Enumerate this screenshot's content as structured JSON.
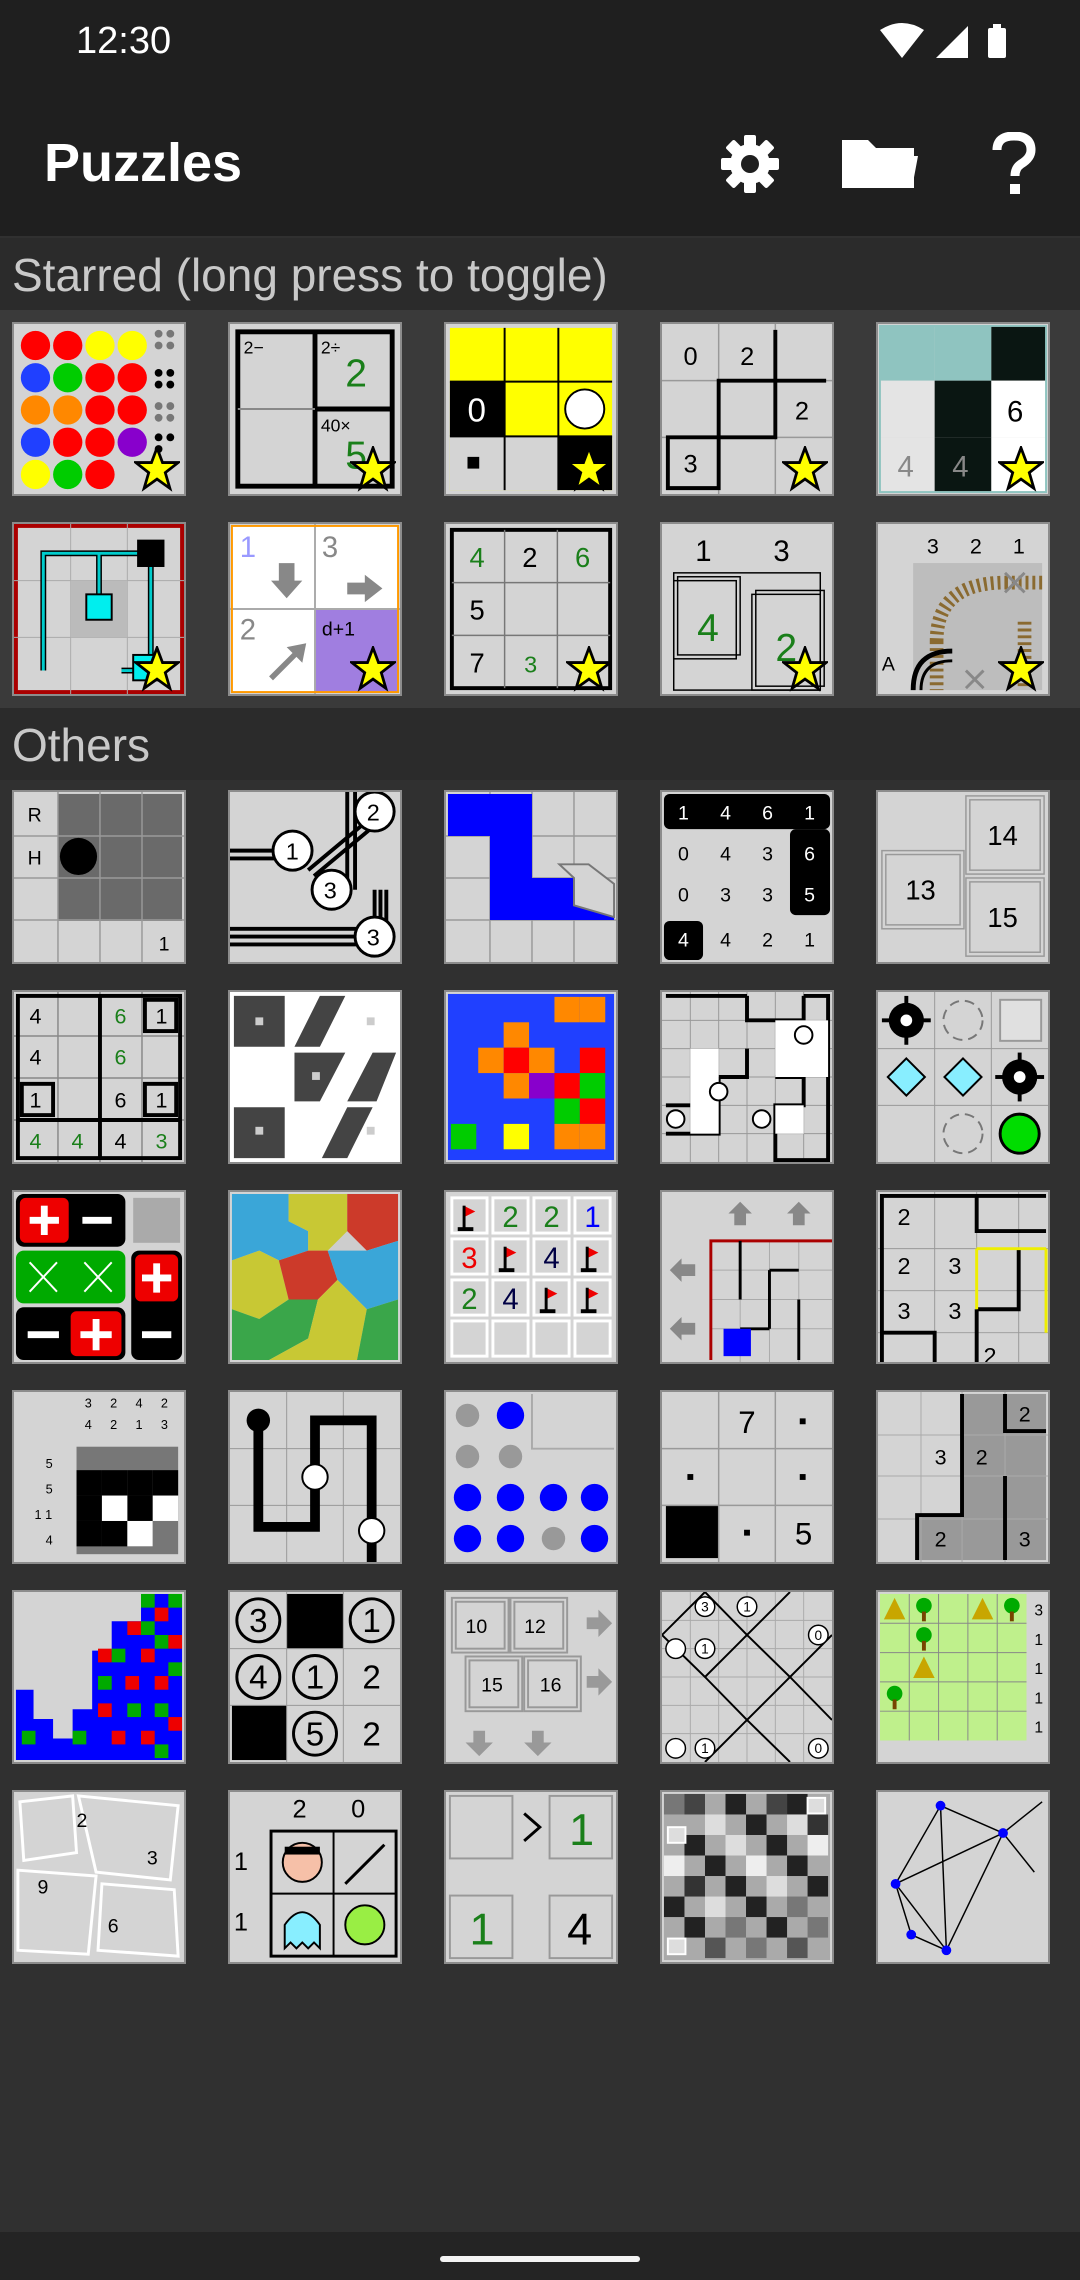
{
  "status_bar": {
    "time": "12:30",
    "icons": [
      "wifi-icon",
      "signal-icon",
      "battery-icon"
    ]
  },
  "app_bar": {
    "title": "Puzzles",
    "actions": [
      "gear-icon",
      "folder-icon",
      "help-icon"
    ]
  },
  "sections": {
    "starred": {
      "header": "Starred (long press to toggle)"
    },
    "others": {
      "header": "Others"
    }
  },
  "tiles_text": {
    "keen": {
      "t1": "2−",
      "t2": "2÷",
      "t3": "2",
      "t4": "40×",
      "t5": "5"
    },
    "lightup": {
      "t1": "0"
    },
    "slant": {
      "t1": "0",
      "t2": "2",
      "t3": "2",
      "t4": "3"
    },
    "unequal_tint": {
      "t1": "6",
      "t2": "4",
      "t3": "4"
    },
    "signpost": {
      "t1": "1",
      "t2": "3",
      "t3": "2",
      "t4": "d+1"
    },
    "towers": {
      "t1": "4",
      "t2": "2",
      "t3": "6",
      "t4": "5",
      "t5": "7",
      "t6": "3"
    },
    "tents_like": {
      "t1": "1",
      "t2": "3",
      "t3": "4",
      "t4": "2"
    },
    "tracks": {
      "t1": "3",
      "t2": "2",
      "t3": "1",
      "t4": "A"
    },
    "pegs_label": {
      "t1": "R",
      "t2": "H",
      "t3": "1"
    },
    "bridges": {
      "t1": "2",
      "t2": "1",
      "t3": "3",
      "t4": "3"
    },
    "range": {
      "r1": [
        "1",
        "4",
        "6",
        "1"
      ],
      "r2": [
        "0",
        "4",
        "3",
        "6"
      ],
      "r3": [
        "0",
        "3",
        "3",
        "5"
      ],
      "r4": [
        "4",
        "4",
        "2",
        "1"
      ]
    },
    "filling": {
      "t1": "14",
      "t2": "13",
      "t3": "15"
    },
    "unruly_grid": {
      "r1": [
        "4",
        "6",
        "1"
      ],
      "r2": [
        "4",
        "6"
      ],
      "r3": [
        "1",
        "6",
        "1"
      ],
      "r4": [
        "4",
        "4",
        "4",
        "3"
      ]
    },
    "mines": {
      "r1": [
        "2",
        "2",
        "1"
      ],
      "r2": [
        "3",
        "4"
      ],
      "r3": [
        "2",
        "4"
      ]
    },
    "singles": {
      "t1": "2",
      "t2": "2",
      "t3": "3",
      "t4": "3",
      "t5": "3",
      "t6": "2"
    },
    "pattern": {
      "top": [
        "3",
        "2",
        "4",
        "2",
        "4",
        "2",
        "1",
        "3"
      ],
      "side": [
        "5",
        "5",
        "1 1",
        "4"
      ]
    },
    "magnets": {
      "t1": "7",
      "t2": "5"
    },
    "dominosa": {
      "t1": "2",
      "t2": "3",
      "t3": "2",
      "t4": "2",
      "t5": "3"
    },
    "circles": {
      "t1": "3",
      "t2": "1",
      "t3": "4",
      "t4": "1",
      "t5": "2",
      "t6": "5",
      "t7": "2"
    },
    "sixteen": {
      "t1": "10",
      "t2": "12",
      "t3": "15",
      "t4": "16"
    },
    "loopy_nums": {
      "t1": "3",
      "t2": "1",
      "t3": "1",
      "t4": "0",
      "t5": "1",
      "t6": "0"
    },
    "tents_side": {
      "t1": "3",
      "t2": "1",
      "t3": "1",
      "t4": "1",
      "t5": "1"
    },
    "cube_tiles": {
      "t1": "2",
      "t2": "3",
      "t3": "9",
      "t4": "6"
    },
    "undead": {
      "t1": "2",
      "t2": "0",
      "t3": "1",
      "t4": "1"
    },
    "unequal": {
      "t1": "1",
      "t2": "1",
      "t3": "4"
    }
  },
  "colors": {
    "background": "#303030",
    "bar": "#1f1f1f",
    "tile_bg": "#d4d4d4",
    "star": "#ffff00",
    "puzzle_green": "#1a7f1a",
    "puzzle_blue": "#0000ff"
  }
}
